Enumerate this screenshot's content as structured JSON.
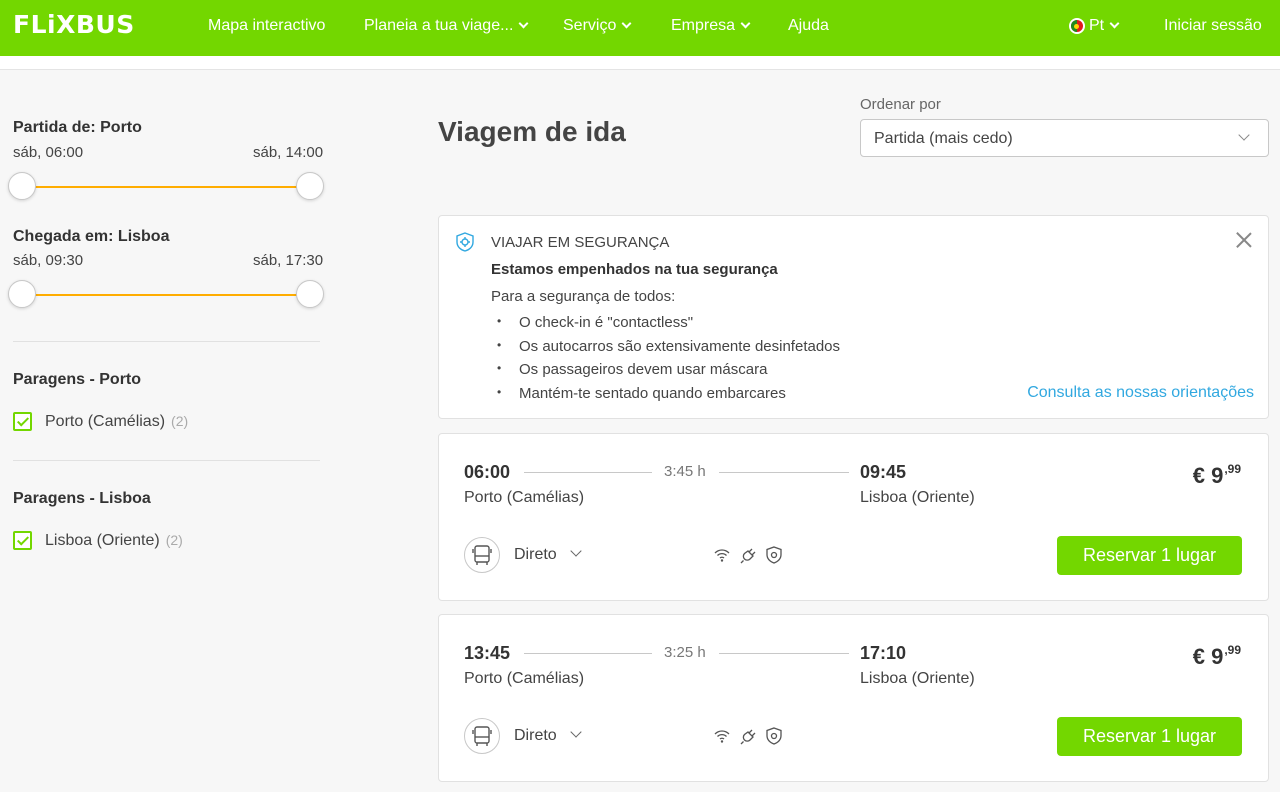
{
  "header": {
    "logo": "FLiXBUS",
    "nav": [
      "Mapa interactivo",
      "Planeia a tua viage...",
      "Serviço",
      "Empresa",
      "Ajuda"
    ],
    "language": "Pt",
    "login": "Iniciar sessão",
    "brand_color": "#73d700"
  },
  "filters": {
    "departure": {
      "title": "Partida de: Porto",
      "min": "sáb, 06:00",
      "max": "sáb, 14:00"
    },
    "arrival": {
      "title": "Chegada em: Lisboa",
      "min": "sáb, 09:30",
      "max": "sáb, 17:30"
    },
    "stops_porto": {
      "title": "Paragens - Porto",
      "option": "Porto (Camélias)",
      "count": "(2)"
    },
    "stops_lisboa": {
      "title": "Paragens - Lisboa",
      "option": "Lisboa (Oriente)",
      "count": "(2)"
    }
  },
  "main": {
    "title": "Viagem de ida",
    "sort_label": "Ordenar por",
    "sort_value": "Partida (mais cedo)"
  },
  "safety": {
    "title": "VIAJAR EM SEGURANÇA",
    "subtitle": "Estamos empenhados na tua segurança",
    "intro": "Para a segurança de todos:",
    "bullets": [
      "O check-in é \"contactless\"",
      "Os autocarros são extensivamente desinfetados",
      "Os passageiros devem usar máscara",
      "Mantém-te sentado quando embarcares"
    ],
    "link": "Consulta as nossas orientações"
  },
  "trips": [
    {
      "dep_time": "06:00",
      "dep_station": "Porto (Camélias)",
      "duration": "3:45 h",
      "arr_time": "09:45",
      "arr_station": "Lisboa (Oriente)",
      "price_main": "€ 9",
      "price_cents": ",99",
      "type": "Direto",
      "button": "Reservar 1 lugar"
    },
    {
      "dep_time": "13:45",
      "dep_station": "Porto (Camélias)",
      "duration": "3:25 h",
      "arr_time": "17:10",
      "arr_station": "Lisboa (Oriente)",
      "price_main": "€ 9",
      "price_cents": ",99",
      "type": "Direto",
      "button": "Reservar 1 lugar"
    }
  ],
  "icons": [
    "wifi-icon",
    "power-plug-icon",
    "safety-shield-icon",
    "bus-icon",
    "chevron-down-icon",
    "close-icon"
  ]
}
